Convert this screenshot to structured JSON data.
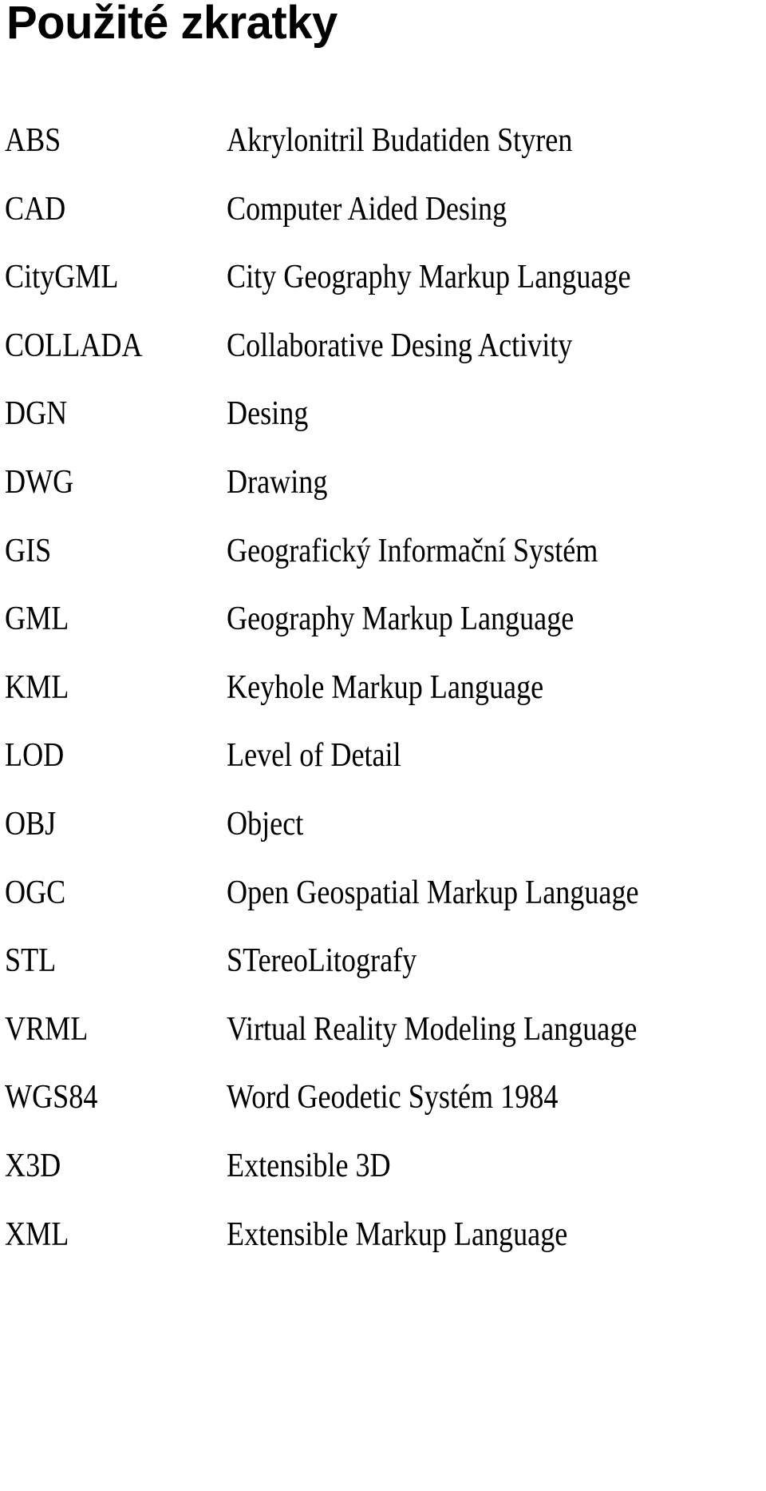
{
  "page": {
    "title": "Použité zkratky"
  },
  "abbreviations": [
    {
      "term": "ABS",
      "definition": "Akrylonitril Budatiden Styren"
    },
    {
      "term": "CAD",
      "definition": "Computer Aided Desing"
    },
    {
      "term": "CityGML",
      "definition": "City Geography Markup Language"
    },
    {
      "term": "COLLADA",
      "definition": "Collaborative Desing Activity"
    },
    {
      "term": "DGN",
      "definition": "Desing"
    },
    {
      "term": "DWG",
      "definition": "Drawing"
    },
    {
      "term": "GIS",
      "definition": "Geografický Informační Systém"
    },
    {
      "term": "GML",
      "definition": "Geography Markup Language"
    },
    {
      "term": "KML",
      "definition": "Keyhole Markup Language"
    },
    {
      "term": "LOD",
      "definition": "Level of Detail"
    },
    {
      "term": "OBJ",
      "definition": "Object"
    },
    {
      "term": "OGC",
      "definition": "Open Geospatial Markup Language"
    },
    {
      "term": "STL",
      "definition": "STereoLitografy"
    },
    {
      "term": "VRML",
      "definition": "Virtual Reality Modeling Language"
    },
    {
      "term": "WGS84",
      "definition": "Word Geodetic Systém 1984"
    },
    {
      "term": "X3D",
      "definition": "Extensible 3D"
    },
    {
      "term": "XML",
      "definition": "Extensible Markup Language"
    }
  ]
}
